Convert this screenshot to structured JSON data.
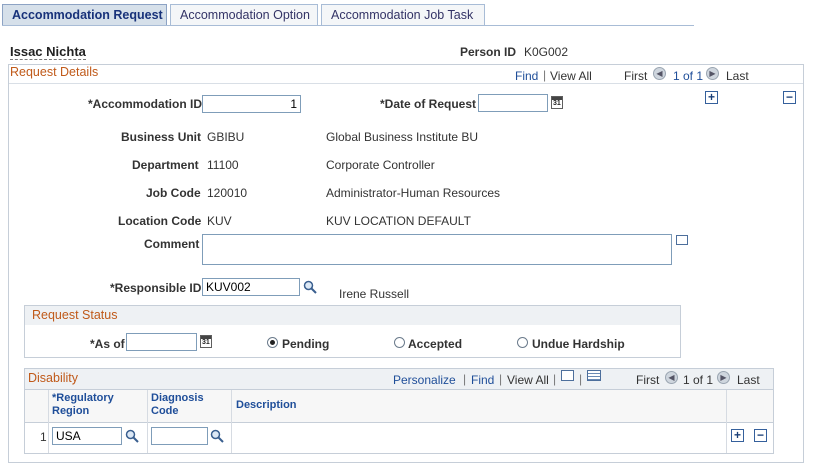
{
  "tabs": [
    {
      "label": "Accommodation Request"
    },
    {
      "label": "Accommodation Option"
    },
    {
      "label": "Accommodation Job Task"
    }
  ],
  "header": {
    "person_name": "Issac Nichta",
    "person_id_label": "Person ID",
    "person_id_value": "K0G002"
  },
  "request_details": {
    "title": "Request Details",
    "nav": {
      "find": "Find",
      "view_all": "View All",
      "first": "First",
      "count": "1 of 1",
      "last": "Last"
    },
    "fields": {
      "accommodation_id_label": "*Accommodation ID",
      "accommodation_id_value": "1",
      "date_of_request_label": "*Date of Request",
      "date_of_request_value": "",
      "business_unit_label": "Business Unit",
      "business_unit_code": "GBIBU",
      "business_unit_desc": "Global Business Institute BU",
      "department_label": "Department",
      "department_code": "11100",
      "department_desc": "Corporate Controller",
      "job_code_label": "Job Code",
      "job_code_code": "120010",
      "job_code_desc": "Administrator-Human Resources",
      "location_code_label": "Location Code",
      "location_code_code": "KUV",
      "location_code_desc": "KUV LOCATION DEFAULT",
      "comment_label": "Comment",
      "comment_value": "",
      "responsible_id_label": "*Responsible ID",
      "responsible_id_value": "KUV002",
      "responsible_name": "Irene Russell"
    }
  },
  "request_status": {
    "title": "Request Status",
    "as_of_label": "*As of",
    "as_of_value": "",
    "options": [
      {
        "label": "Pending",
        "selected": true
      },
      {
        "label": "Accepted",
        "selected": false
      },
      {
        "label": "Undue Hardship",
        "selected": false
      }
    ]
  },
  "disability": {
    "title": "Disability",
    "nav": {
      "personalize": "Personalize",
      "find": "Find",
      "view_all": "View All",
      "first": "First",
      "count": "1 of 1",
      "last": "Last"
    },
    "columns": [
      {
        "line1": "*Regulatory",
        "line2": "Region"
      },
      {
        "line1": "Diagnosis",
        "line2": "Code"
      },
      {
        "line1": "Description",
        "line2": ""
      }
    ],
    "rows": [
      {
        "num": "1",
        "regulatory_region": "USA",
        "diagnosis_code": "",
        "description": ""
      }
    ]
  },
  "icons": {
    "add": "+",
    "remove": "−",
    "prev": "◀",
    "next": "▶",
    "calendar_text": "31"
  },
  "colors": {
    "section_title": "#c05a1a",
    "link": "#1f4e99",
    "border": "#c6ced8",
    "header_bg": "#d6e0ea"
  }
}
